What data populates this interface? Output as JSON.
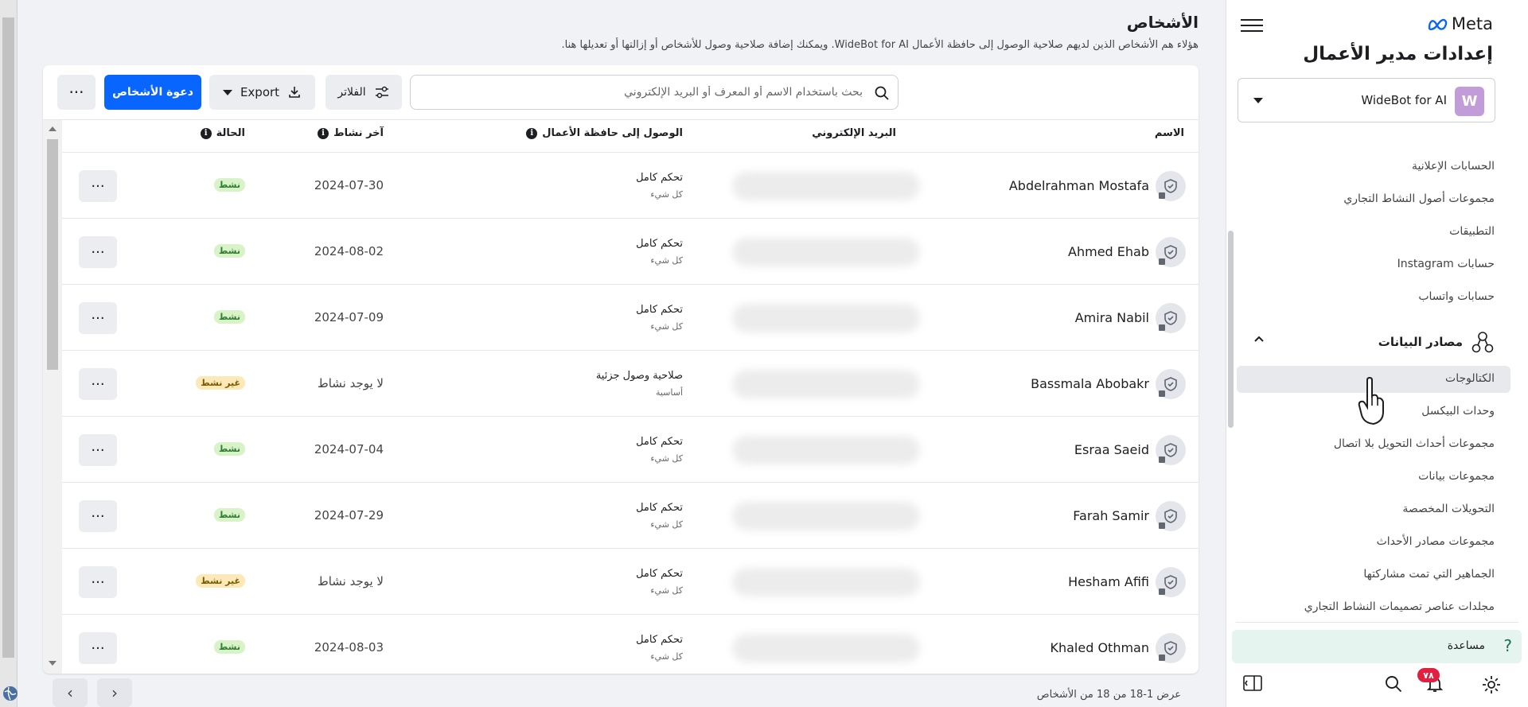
{
  "header": {
    "title": "الأشخاص",
    "description": "هؤلاء هم الأشخاص الذين لديهم صلاحية الوصول إلى حافظة الأعمال WideBot for AI. ويمكنك إضافة صلاحية وصول للأشخاص أو إزالتها أو تعديلها هنا."
  },
  "toolbar": {
    "search_placeholder": "بحث باستخدام الاسم أو المعرف أو البريد الإلكتروني",
    "filters_label": "الفلاتر",
    "export_label": "Export",
    "invite_label": "دعوة الأشخاص",
    "more_label": "···"
  },
  "table": {
    "columns": {
      "name": "الاسم",
      "email": "البريد الإلكتروني",
      "access": "الوصول إلى حافظة الأعمال",
      "last_activity": "آخر نشاط",
      "status": "الحالة"
    },
    "rows": [
      {
        "name": "Abdelrahman Mostafa",
        "access": "تحكم كامل",
        "access_sub": "كل شيء",
        "last_activity": "2024-07-30",
        "status": "نشط",
        "status_kind": "active"
      },
      {
        "name": "Ahmed Ehab",
        "access": "تحكم كامل",
        "access_sub": "كل شيء",
        "last_activity": "2024-08-02",
        "status": "نشط",
        "status_kind": "active"
      },
      {
        "name": "Amira Nabil",
        "access": "تحكم كامل",
        "access_sub": "كل شيء",
        "last_activity": "2024-07-09",
        "status": "نشط",
        "status_kind": "active"
      },
      {
        "name": "Bassmala Abobakr",
        "access": "صلاحية وصول جزئية",
        "access_sub": "أساسية",
        "last_activity": "لا يوجد نشاط",
        "status": "غير نشط",
        "status_kind": "inactive"
      },
      {
        "name": "Esraa Saeid",
        "access": "تحكم كامل",
        "access_sub": "كل شيء",
        "last_activity": "2024-07-04",
        "status": "نشط",
        "status_kind": "active"
      },
      {
        "name": "Farah Samir",
        "access": "تحكم كامل",
        "access_sub": "كل شيء",
        "last_activity": "2024-07-29",
        "status": "نشط",
        "status_kind": "active"
      },
      {
        "name": "Hesham Afifi",
        "access": "تحكم كامل",
        "access_sub": "كل شيء",
        "last_activity": "لا يوجد نشاط",
        "status": "غير نشط",
        "status_kind": "inactive"
      },
      {
        "name": "Khaled Othman",
        "access": "تحكم كامل",
        "access_sub": "كل شيء",
        "last_activity": "2024-08-03",
        "status": "نشط",
        "status_kind": "active"
      }
    ]
  },
  "footer": {
    "count_text": "عرض 1-18 من 18 من الأشخاص",
    "prev": "‹",
    "next": "›"
  },
  "sidebar": {
    "logo_text": "Meta",
    "title": "إعدادات مدير الأعمال",
    "account": {
      "initial": "W",
      "name": "WideBot for AI"
    },
    "items": [
      {
        "label": "الحسابات الإعلانية"
      },
      {
        "label": "مجموعات أصول النشاط التجاري"
      },
      {
        "label": "التطبيقات"
      },
      {
        "label": "حسابات Instagram"
      },
      {
        "label": "حسابات واتساب"
      }
    ],
    "data_sources": {
      "title": "مصادر البيانات",
      "items": [
        {
          "label": "الكتالوجات",
          "selected": true
        },
        {
          "label": "وحدات البيكسل"
        },
        {
          "label": "مجموعات أحداث التحويل بلا اتصال"
        },
        {
          "label": "مجموعات بيانات"
        },
        {
          "label": "التحويلات المخصصة"
        },
        {
          "label": "مجموعات مصادر الأحداث"
        },
        {
          "label": "الجماهير التي تمت مشاركتها"
        },
        {
          "label": "مجلدات عناصر تصميمات النشاط التجاري"
        }
      ]
    },
    "help_label": "مساعدة",
    "notifications_count": "٧٨"
  },
  "colors": {
    "primary": "#0866ff",
    "active_badge": "#d8f3c8",
    "inactive_badge": "#fde9b8",
    "notification": "#e41e3f",
    "help_bg": "#e5f4ef"
  },
  "icons": [
    "search-icon",
    "filter-icon",
    "download-icon",
    "info-icon",
    "shield-icon",
    "hamburger-icon",
    "meta-logo-icon",
    "data-sources-icon",
    "chevron-up-icon",
    "help-icon",
    "settings-icon",
    "bell-icon",
    "sidebar-toggle-icon",
    "globe-icon",
    "cursor-icon"
  ]
}
